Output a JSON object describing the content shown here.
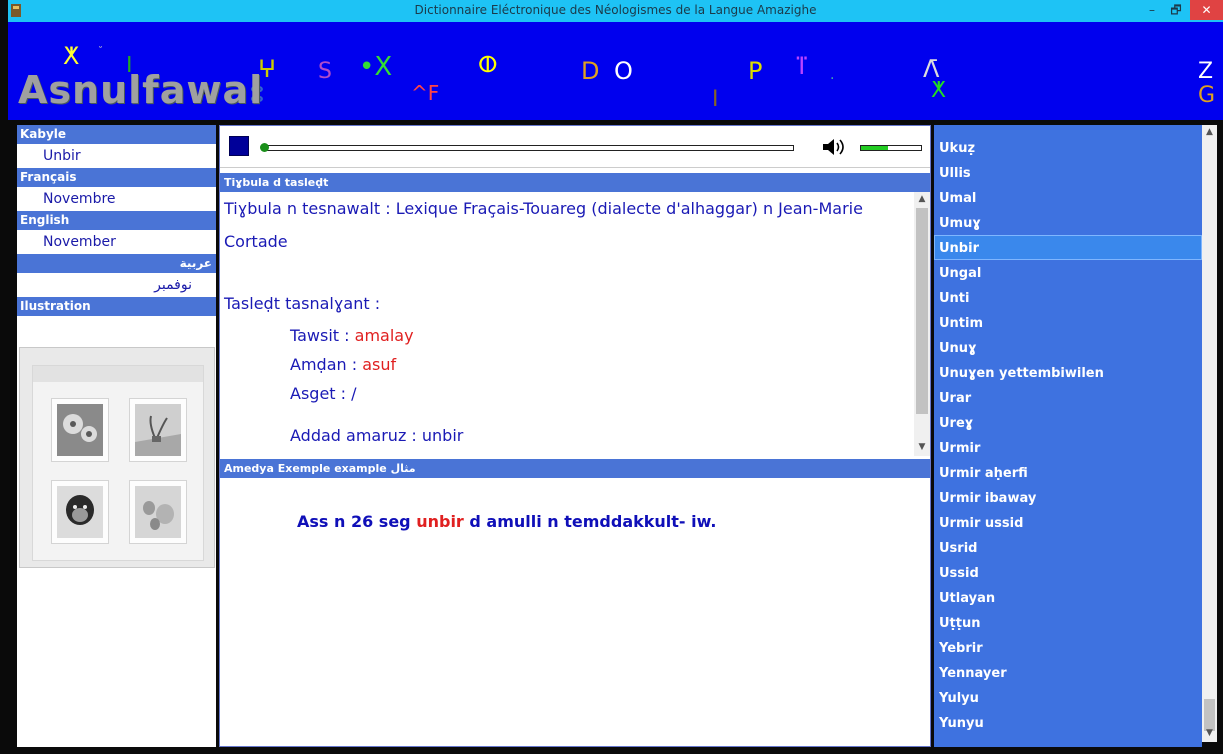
{
  "window": {
    "title": "Dictionnaire Eléctronique des Néologismes de la Langue Amazighe",
    "minimize": "–",
    "maximize": "🗗",
    "close": "✕"
  },
  "banner": {
    "logo": "Asnulfawal",
    "background": "#0000ee"
  },
  "translations": {
    "kabyle_label": "Kabyle",
    "kabyle_value": "Unbir",
    "french_label": "Français",
    "french_value": "Novembre",
    "english_label": "English",
    "english_value": "November",
    "arabic_label": "عربية",
    "arabic_value": "نوفمبر",
    "illustration_label": "Ilustration"
  },
  "player": {
    "volume_level": 0.45
  },
  "definition": {
    "header": "Tiɣbula d tasleḍt",
    "source_line1": "Tiɣbula n tesnawalt : Lexique Fraçais-Touareg (dialecte d'alhaggar) n Jean-Marie",
    "source_line2": "Cortade",
    "analysis_label": "Tasleḍt tasnalɣant :",
    "tawsit_label": "Tawsit : ",
    "tawsit_value": "amalay",
    "amdan_label": "Amḍan : ",
    "amdan_value": "asuf",
    "asget_label": "Asget  : /",
    "addad_label": "Addad amaruz : unbir"
  },
  "example": {
    "header": "Amedya  Exemple  example  مثال",
    "prefix": "Ass n 26 seg ",
    "highlight": "unbir",
    "suffix": " d amulli n temddakkult- iw."
  },
  "word_list": {
    "items": [
      "Ukuẓ",
      "Ullis",
      "Umal",
      "Umuɣ",
      "Unbir",
      "Ungal",
      "Unti",
      "Untim",
      "Unuɣ",
      "Unuɣen yettembiwilen",
      "Urar",
      "Ureɣ",
      "Urmir",
      "Urmir aḥerfi",
      "Urmir ibaway",
      "Urmir ussid",
      "Usrid",
      "Ussid",
      "Utlayan",
      "Uṭṭun",
      "Yebrir",
      "Yennayer",
      "Yulyu",
      "Yunyu"
    ],
    "selected": "Unbir"
  },
  "colors": {
    "accent_header": "#4a74d6",
    "list_background": "#3e72e0",
    "highlight_red": "#e02020",
    "text_blue": "#1a1ab5"
  }
}
